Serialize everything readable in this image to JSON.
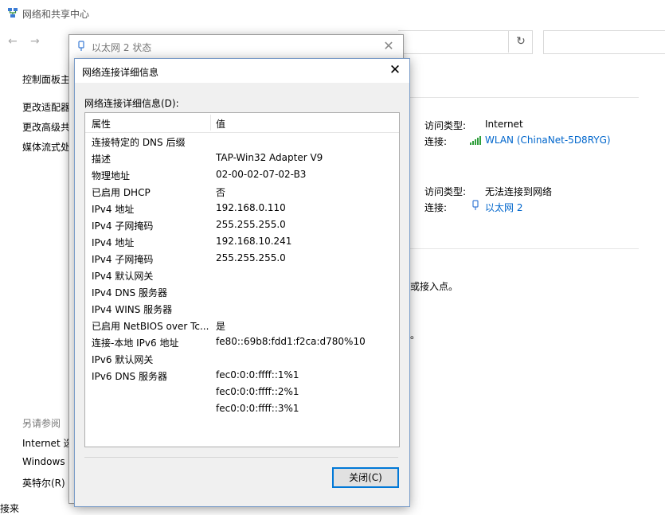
{
  "background": {
    "title": "网络和共享中心",
    "sidebar": {
      "items": [
        "控制面板主",
        "更改适配器",
        "更改高级共",
        "媒体流式处"
      ],
      "see_also_heading": "另请参阅",
      "see_also": [
        "Internet 选",
        "Windows",
        "英特尔(R)"
      ]
    },
    "networks": [
      {
        "access_label": "访问类型:",
        "access_value": "Internet",
        "conn_label": "连接:",
        "conn_value": "WLAN (ChinaNet-5D8RYG)"
      },
      {
        "access_label": "访问类型:",
        "access_value": "无法连接到网络",
        "conn_label": "连接:",
        "conn_value": "以太网 2"
      }
    ],
    "fragments": [
      "或接入点。",
      "。"
    ],
    "bottom_cut": "接来"
  },
  "status_dialog": {
    "title": "以太网 2 状态",
    "close_glyph": "✕"
  },
  "details_dialog": {
    "title": "网络连接详细信息",
    "close_glyph": "✕",
    "label": "网络连接详细信息(D):",
    "columns": {
      "property": "属性",
      "value": "值"
    },
    "rows": [
      {
        "property": "连接特定的 DNS 后缀",
        "value": ""
      },
      {
        "property": "描述",
        "value": "TAP-Win32 Adapter V9"
      },
      {
        "property": "物理地址",
        "value": "02-00-02-07-02-B3"
      },
      {
        "property": "已启用 DHCP",
        "value": "否"
      },
      {
        "property": "IPv4 地址",
        "value": "192.168.0.110"
      },
      {
        "property": "IPv4 子网掩码",
        "value": "255.255.255.0"
      },
      {
        "property": "IPv4 地址",
        "value": "192.168.10.241"
      },
      {
        "property": "IPv4 子网掩码",
        "value": "255.255.255.0"
      },
      {
        "property": "IPv4 默认网关",
        "value": ""
      },
      {
        "property": "IPv4 DNS 服务器",
        "value": ""
      },
      {
        "property": "IPv4 WINS 服务器",
        "value": ""
      },
      {
        "property": "已启用 NetBIOS over Tc...",
        "value": "是"
      },
      {
        "property": "连接-本地 IPv6 地址",
        "value": "fe80::69b8:fdd1:f2ca:d780%10"
      },
      {
        "property": "IPv6 默认网关",
        "value": ""
      },
      {
        "property": "IPv6 DNS 服务器",
        "value": "fec0:0:0:ffff::1%1"
      },
      {
        "property": "",
        "value": "fec0:0:0:ffff::2%1"
      },
      {
        "property": "",
        "value": "fec0:0:0:ffff::3%1"
      }
    ],
    "close_button": "关闭(C)"
  },
  "colors": {
    "link": "#0066cc",
    "focus": "#0078d7",
    "wifi": "#2e9e3a"
  }
}
